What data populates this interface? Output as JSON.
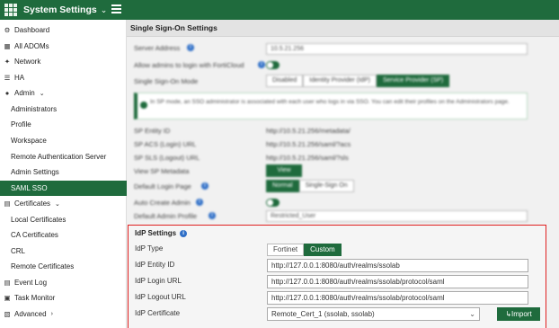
{
  "topbar": {
    "app_title": "System Settings",
    "chevron": "⌄"
  },
  "sidebar": {
    "items": [
      {
        "icon": "⚙",
        "label": "Dashboard"
      },
      {
        "icon": "▦",
        "label": "All ADOMs"
      },
      {
        "icon": "✦",
        "label": "Network"
      },
      {
        "icon": "☰",
        "label": "HA"
      },
      {
        "icon": "●",
        "label": "Admin",
        "tail": "⌄"
      },
      {
        "label": "Administrators"
      },
      {
        "label": "Profile"
      },
      {
        "label": "Workspace"
      },
      {
        "label": "Remote Authentication Server"
      },
      {
        "label": "Admin Settings"
      },
      {
        "label": "SAML SSO",
        "active": true
      },
      {
        "icon": "▤",
        "label": "Certificates",
        "tail": "⌄"
      },
      {
        "label": "Local Certificates"
      },
      {
        "label": "CA Certificates"
      },
      {
        "label": "CRL"
      },
      {
        "label": "Remote Certificates"
      },
      {
        "icon": "▤",
        "label": "Event Log"
      },
      {
        "icon": "▣",
        "label": "Task Monitor"
      },
      {
        "icon": "▧",
        "label": "Advanced",
        "tail": "›"
      }
    ]
  },
  "panel": {
    "title": "Single Sign-On Settings"
  },
  "blurred": {
    "server_address_label": "Server Address",
    "server_address_value": "10.5.21.256",
    "allow_forticloud_label": "Allow admins to login with FortiCloud",
    "sso_mode_label": "Single Sign-On Mode",
    "sso_mode_options": [
      "Disabled",
      "Identity Provider (IdP)",
      "Service Provider (SP)"
    ],
    "notice_text": "In SP mode, an SSO administrator is associated with each user who logs in via SSO. You can edit their profiles on the Administrators page.",
    "sp_entity_label": "SP Entity ID",
    "sp_entity_value": "http://10.5.21.256/metadata/",
    "sp_acs_label": "SP ACS (Login) URL",
    "sp_acs_value": "http://10.5.21.256/saml/?acs",
    "sp_sls_label": "SP SLS (Logout) URL",
    "sp_sls_value": "http://10.5.21.256/saml/?sls",
    "view_metadata_label": "View SP Metadata",
    "view_button": "View",
    "default_login_label": "Default Login Page",
    "default_login_options": [
      "Normal",
      "Single-Sign On"
    ],
    "auto_create_label": "Auto Create Admin",
    "default_profile_label": "Default Admin Profile",
    "default_profile_value": "Restricted_User"
  },
  "idp": {
    "title": "IdP Settings",
    "type_label": "IdP Type",
    "type_options": [
      "Fortinet",
      "Custom"
    ],
    "entity_label": "IdP Entity ID",
    "entity_value": "http://127.0.0.1:8080/auth/realms/ssolab",
    "login_label": "IdP Login URL",
    "login_value": "http://127.0.0.1:8080/auth/realms/ssolab/protocol/saml",
    "logout_label": "IdP Logout URL",
    "logout_value": "http://127.0.0.1:8080/auth/realms/ssolab/protocol/saml",
    "cert_label": "IdP Certificate",
    "cert_value": "Remote_Cert_1 (ssolab, ssolab)",
    "import_label": "Import"
  },
  "colors": {
    "brand": "#1f6b3d",
    "highlight": "#e02020"
  }
}
